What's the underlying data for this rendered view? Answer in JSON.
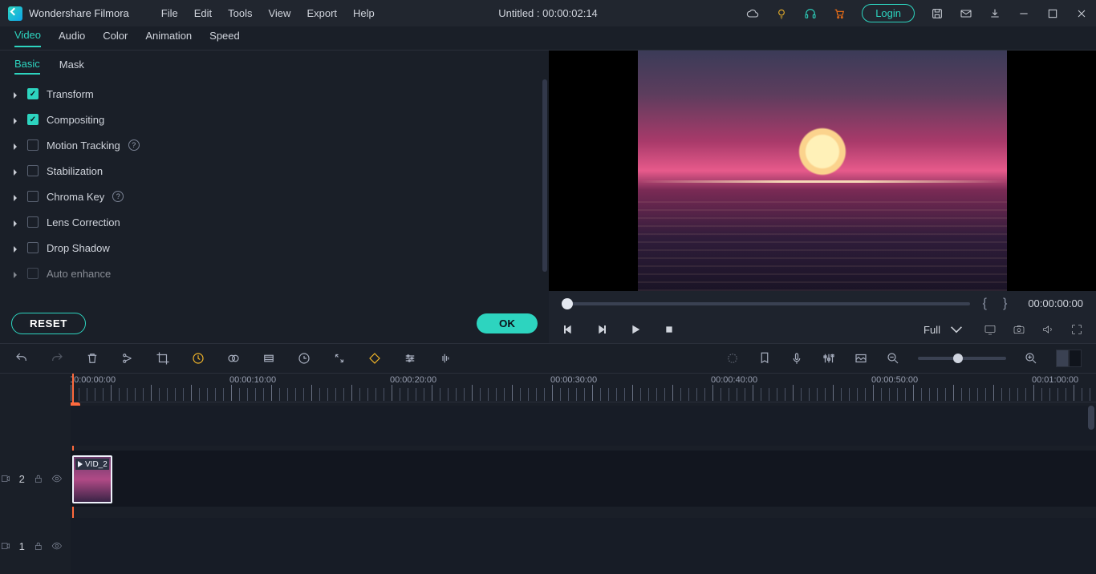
{
  "app": {
    "name": "Wondershare Filmora"
  },
  "menu": [
    "File",
    "Edit",
    "Tools",
    "View",
    "Export",
    "Help"
  ],
  "document_title": "Untitled : 00:00:02:14",
  "login_label": "Login",
  "edit_tabs": [
    "Video",
    "Audio",
    "Color",
    "Animation",
    "Speed"
  ],
  "edit_tab_active": 0,
  "sub_tabs": [
    "Basic",
    "Mask"
  ],
  "sub_tab_active": 0,
  "options": [
    {
      "label": "Transform",
      "checked": true,
      "info": false
    },
    {
      "label": "Compositing",
      "checked": true,
      "info": false
    },
    {
      "label": "Motion Tracking",
      "checked": false,
      "info": true
    },
    {
      "label": "Stabilization",
      "checked": false,
      "info": false
    },
    {
      "label": "Chroma Key",
      "checked": false,
      "info": true
    },
    {
      "label": "Lens Correction",
      "checked": false,
      "info": false
    },
    {
      "label": "Drop Shadow",
      "checked": false,
      "info": false
    },
    {
      "label": "Auto enhance",
      "checked": false,
      "info": false
    }
  ],
  "buttons": {
    "reset": "RESET",
    "ok": "OK"
  },
  "preview": {
    "timecode": "00:00:00:00",
    "quality": "Full"
  },
  "ruler": [
    "00:00:00:00",
    "00:00:10:00",
    "00:00:20:00",
    "00:00:30:00",
    "00:00:40:00",
    "00:00:50:00",
    "00:01:00:00"
  ],
  "tracks": [
    {
      "id": "2",
      "clip_label": "VID_2"
    },
    {
      "id": "1"
    }
  ]
}
